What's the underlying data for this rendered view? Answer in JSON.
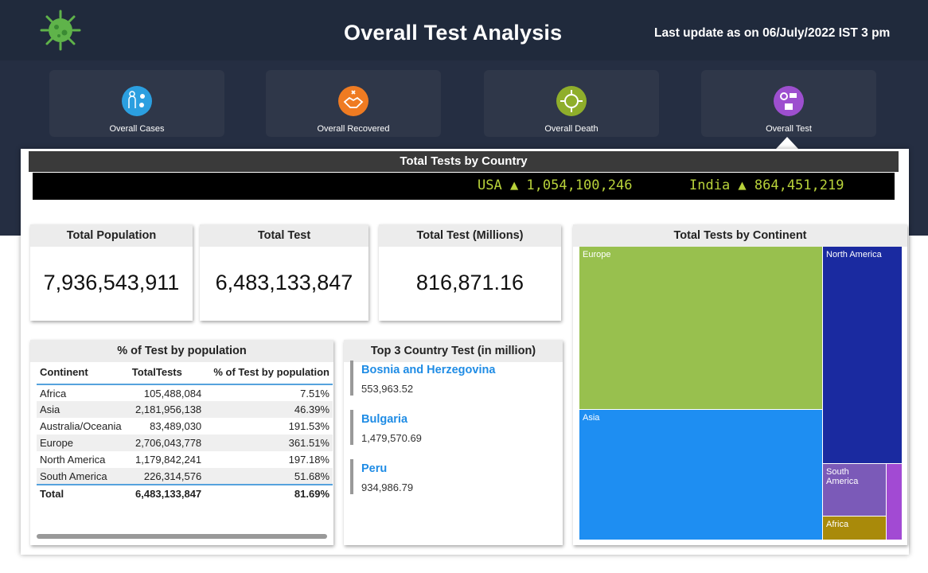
{
  "header": {
    "title": "Overall Test Analysis",
    "update": "Last update as on 06/July/2022  IST 3 pm",
    "logo_icon": "virus-icon"
  },
  "nav": [
    {
      "label": "Overall Cases",
      "icon": "people-icon",
      "color": "#2b9fe0"
    },
    {
      "label": "Overall Recovered",
      "icon": "handshake-icon",
      "color": "#ef7b22"
    },
    {
      "label": "Overall Death",
      "icon": "virus-icon",
      "color": "#8fae2b"
    },
    {
      "label": "Overall Test",
      "icon": "test-icon",
      "color": "#9d4fcf"
    }
  ],
  "ticker": {
    "title": "Total Tests by Country",
    "items": [
      "USA ▲ 1,054,100,246",
      "India ▲ 864,451,219"
    ]
  },
  "kpis": [
    {
      "title": "Total Population",
      "value": "7,936,543,911"
    },
    {
      "title": "Total Test",
      "value": "6,483,133,847"
    },
    {
      "title": "Total Test (Millions)",
      "value": "816,871.16"
    }
  ],
  "pct_table": {
    "title": "% of Test by population",
    "columns": [
      "Continent",
      "TotalTests",
      "% of Test by population"
    ],
    "rows": [
      [
        "Africa",
        "105,488,084",
        "7.51%"
      ],
      [
        "Asia",
        "2,181,956,138",
        "46.39%"
      ],
      [
        "Australia/Oceania",
        "83,489,030",
        "191.53%"
      ],
      [
        "Europe",
        "2,706,043,778",
        "361.51%"
      ],
      [
        "North America",
        "1,179,842,241",
        "197.18%"
      ],
      [
        "South America",
        "226,314,576",
        "51.68%"
      ]
    ],
    "total": [
      "Total",
      "6,483,133,847",
      "81.69%"
    ]
  },
  "top3": {
    "title": "Top 3 Country Test (in million)",
    "items": [
      {
        "name": "Bosnia and Herzegovina",
        "value": "553,963.52"
      },
      {
        "name": "Bulgaria",
        "value": "1,479,570.69"
      },
      {
        "name": "Peru",
        "value": "934,986.79"
      }
    ]
  },
  "treemap": {
    "title": "Total Tests by Continent",
    "cells": [
      {
        "label": "Europe",
        "value": 2706043778,
        "color": "#98c04e"
      },
      {
        "label": "North America",
        "value": 1179842241,
        "color": "#1a2aa0"
      },
      {
        "label": "Asia",
        "value": 2181956138,
        "color": "#1e8ef2"
      },
      {
        "label": "South America",
        "value": 226314576,
        "color": "#7b5ab8"
      },
      {
        "label": "",
        "value": 83489030,
        "color": "#a24ad3"
      },
      {
        "label": "Africa",
        "value": 105488084,
        "color": "#a98a0a"
      }
    ]
  }
}
